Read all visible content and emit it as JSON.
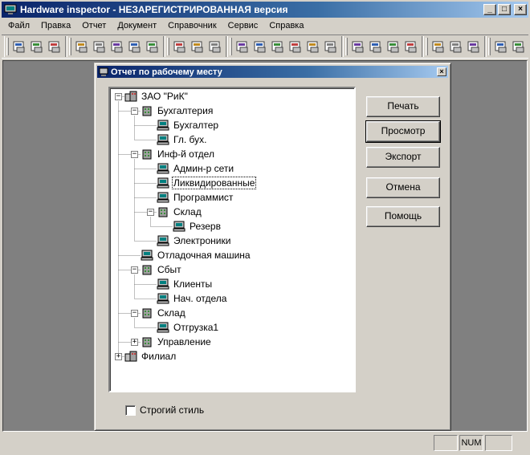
{
  "window": {
    "title": "Hardware inspector - НЕЗАРЕГИСТРИРОВАННАЯ версия",
    "minimize_glyph": "_",
    "maximize_glyph": "□",
    "close_glyph": "×"
  },
  "menu": [
    {
      "label": "Файл"
    },
    {
      "label": "Правка"
    },
    {
      "label": "Отчет"
    },
    {
      "label": "Документ"
    },
    {
      "label": "Справочник"
    },
    {
      "label": "Сервис"
    },
    {
      "label": "Справка"
    }
  ],
  "toolbar_icons": [
    [
      "printer-icon",
      "print-preview-icon",
      "export-excel-icon"
    ],
    [
      "cut-icon",
      "copy-icon",
      "paste-icon",
      "undo-icon",
      "book-icon"
    ],
    [
      "users-icon",
      "binoculars-icon",
      "open-folder-icon"
    ],
    [
      "computer-icon",
      "monitor-icon",
      "document-icon",
      "report-icon",
      "numbered-list-icon",
      "chart-icon"
    ],
    [
      "tools-icon",
      "wrench-icon",
      "cart-icon",
      "hand-icon"
    ],
    [
      "copy-pages-icon",
      "network-icon",
      "layers-icon"
    ],
    [
      "recycle-icon",
      "pc-settings-icon",
      "screwdriver-icon"
    ]
  ],
  "dialog": {
    "title": "Отчет по рабочему месту",
    "close_glyph": "×",
    "tree": [
      {
        "label": "ЗАО \"РиК\"",
        "level": 0,
        "icon": "organization",
        "expander": "−"
      },
      {
        "label": "Бухгалтерия",
        "level": 1,
        "icon": "building",
        "expander": "−"
      },
      {
        "label": "Бухгалтер",
        "level": 2,
        "icon": "computer"
      },
      {
        "label": "Гл. бух.",
        "level": 2,
        "icon": "computer"
      },
      {
        "label": "Инф-й отдел",
        "level": 1,
        "icon": "building",
        "expander": "−"
      },
      {
        "label": "Админ-р сети",
        "level": 2,
        "icon": "computer"
      },
      {
        "label": "Ликвидированные",
        "level": 2,
        "icon": "computer",
        "selected": true
      },
      {
        "label": "Программист",
        "level": 2,
        "icon": "computer"
      },
      {
        "label": "Склад",
        "level": 2,
        "icon": "building",
        "expander": "−"
      },
      {
        "label": "Резерв",
        "level": 3,
        "icon": "computer"
      },
      {
        "label": "Электроники",
        "level": 2,
        "icon": "computer"
      },
      {
        "label": "Отладочная машина",
        "level": 1,
        "icon": "computer"
      },
      {
        "label": "Сбыт",
        "level": 1,
        "icon": "building",
        "expander": "−"
      },
      {
        "label": "Клиенты",
        "level": 2,
        "icon": "computer"
      },
      {
        "label": "Нач. отдела",
        "level": 2,
        "icon": "computer"
      },
      {
        "label": "Склад",
        "level": 1,
        "icon": "building",
        "expander": "−"
      },
      {
        "label": "Отгрузка1",
        "level": 2,
        "icon": "computer"
      },
      {
        "label": "Управление",
        "level": 1,
        "icon": "building",
        "expander": "+"
      },
      {
        "label": "Филиал",
        "level": 0,
        "icon": "organization",
        "expander": "+"
      }
    ],
    "buttons": {
      "print": "Печать",
      "preview": "Просмотр",
      "export": "Экспорт",
      "cancel": "Отмена",
      "help": "Помощь"
    },
    "strict_style": {
      "label": "Строгий стиль",
      "checked": false
    }
  },
  "statusbar": {
    "num": "NUM"
  }
}
